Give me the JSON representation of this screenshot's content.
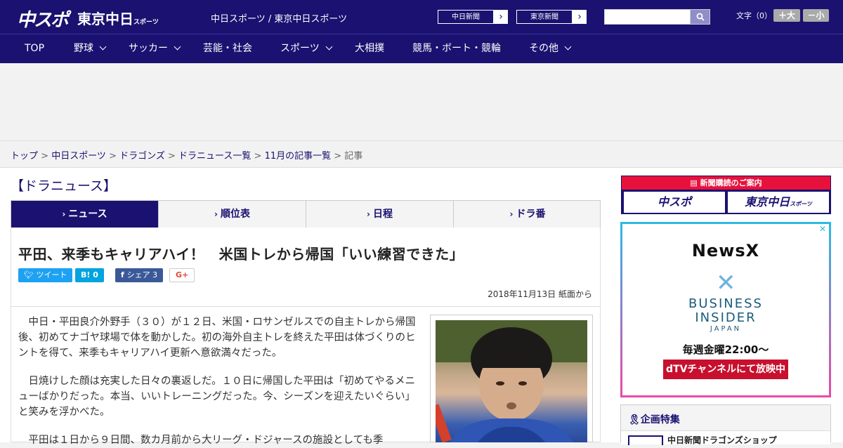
{
  "header": {
    "logo": "中スポ",
    "logo_sub": "東京中日",
    "logo_sub_small": "スポーツ",
    "site_title": "中日スポーツ / 東京中日スポーツ",
    "ext_links": [
      "中日新聞",
      "東京新聞"
    ],
    "font_label": "文字（0）",
    "font_up": "＋大",
    "font_down": "－小"
  },
  "nav": {
    "items": [
      {
        "label": "TOP",
        "dropdown": false
      },
      {
        "label": "野球",
        "dropdown": true
      },
      {
        "label": "サッカー",
        "dropdown": true
      },
      {
        "label": "芸能・社会",
        "dropdown": false
      },
      {
        "label": "スポーツ",
        "dropdown": true
      },
      {
        "label": "大相撲",
        "dropdown": false
      },
      {
        "label": "競馬・ボート・競輪",
        "dropdown": false
      },
      {
        "label": "その他",
        "dropdown": true
      }
    ]
  },
  "breadcrumb": {
    "items": [
      "トップ",
      "中日スポーツ",
      "ドラゴンズ",
      "ドラニュース一覧",
      "11月の記事一覧"
    ],
    "current": "記事",
    "sep": " > "
  },
  "section_title": "【ドラニュース】",
  "tabs": [
    "ニュース",
    "順位表",
    "日程",
    "ドラ番"
  ],
  "article": {
    "headline": "平田、来季もキャリアハイ！　米国トレから帰国「いい練習できた」",
    "share": {
      "tweet": "ツイート",
      "hatena": "B! 0",
      "facebook": "シェア 3",
      "gplus": "G+"
    },
    "date": "2018年11月13日 紙面から",
    "paragraphs": [
      "中日・平田良介外野手（３０）が１２日、米国・ロサンゼルスでの自主トレから帰国後、初めてナゴヤ球場で体を動かした。初の海外自主トレを終えた平田は体づくりのヒントを得て、来季もキャリアハイ更新へ意欲満々だった。",
      "日焼けした顔は充実した日々の裏返しだ。１０日に帰国した平田は「初めてやるメニューばかりだった。本当、いいトレーニングだった。今、シーズンを迎えたいぐらい」と笑みを浮かべた。",
      "平田は１日から９日間、数カ月前から大リーグ・ドジャースの施設としても季"
    ]
  },
  "sidebar": {
    "subscribe_title": "新聞購読のご案内",
    "subscribe_buttons": [
      "中スポ",
      "東京中日"
    ],
    "subscribe_small": "スポーツ",
    "ad": {
      "brand": "NewsX",
      "partner_line1": "BUSINESS",
      "partner_line2": "INSIDER",
      "partner_sub": "JAPAN",
      "schedule": "毎週金曜22:00〜",
      "cta": "dTVチャンネルにて放映中",
      "close": "✕"
    },
    "feature_title": "企画特集",
    "feature_item": "中日新聞ドラゴンズショップ"
  },
  "colors": {
    "navy": "#1a1170",
    "red": "#e8113c",
    "twitter": "#1da1f2",
    "hatena": "#00a4de",
    "facebook": "#3b5998"
  }
}
